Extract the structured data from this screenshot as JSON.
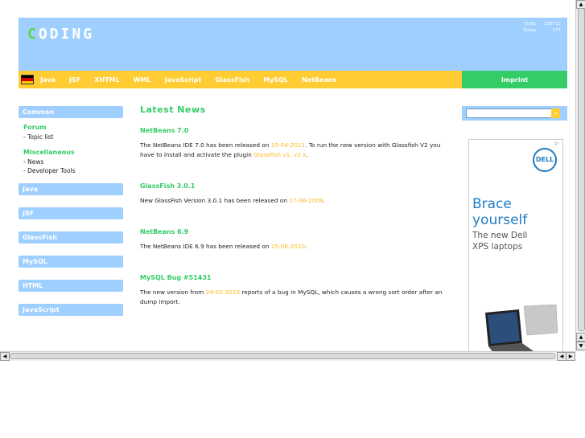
{
  "logo": {
    "first_letter": "C",
    "rest": "ODING"
  },
  "visits": {
    "visits_label": "Visits",
    "visits_value": "216712",
    "today_label": "Today",
    "today_value": "177"
  },
  "nav": {
    "items": [
      "Java",
      "JSF",
      "XHTML",
      "WML",
      "JavaScript",
      "GlassFish",
      "MySQL",
      "NetBeans"
    ],
    "imprint": "Imprint"
  },
  "sidebar": {
    "common": "Common",
    "groups": [
      {
        "title": "Forum",
        "items": [
          "- Topic list"
        ]
      },
      {
        "title": "Miscellaneous",
        "items": [
          "- News",
          "- Developer Tools"
        ]
      }
    ],
    "sections": [
      "Java",
      "JSF",
      "GlassFish",
      "MySQL",
      "HTML",
      "JavaScript"
    ]
  },
  "main": {
    "heading": "Latest News",
    "news": [
      {
        "title": "NetBeans 7.0",
        "pre": "The NetBeans IDE 7.0 has been released on ",
        "date": "15-04-2011",
        "mid": ". To run the new version with Glassfish V2 you have to install and activate the plugin ",
        "link": "GlassFish v1, v2.x",
        "post": "."
      },
      {
        "title": "GlassFish 3.0.1",
        "pre": "New GlassFish Version 3.0.1 has been released on ",
        "date": "17-06-2009",
        "post": "."
      },
      {
        "title": "NetBeans 6.9",
        "pre": "The NetBeans IDE 6.9 has been released on ",
        "date": "15-06-2010",
        "post": "."
      },
      {
        "title": "MySQL Bug #51431",
        "pre": "The new version from ",
        "date": "24-02-2010",
        "post": " reports of a bug in MySQL, which causes a wrong sort order after an dump import."
      }
    ]
  },
  "search": {
    "button": "»"
  },
  "ad": {
    "brand": "DELL",
    "headline1": "Brace",
    "headline2": "yourself",
    "sub1": "The new Dell",
    "sub2": "XPS laptops"
  },
  "colors": {
    "header": "#9fcfff",
    "navbar": "#ffcc33",
    "accent_green": "#33cc66",
    "highlight": "#ffb820"
  }
}
